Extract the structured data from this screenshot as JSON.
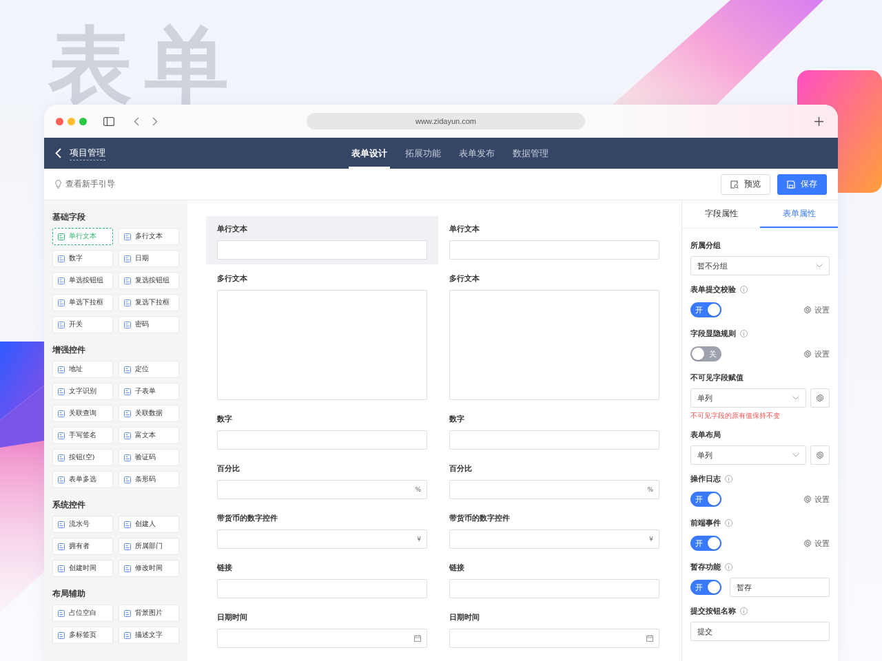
{
  "hero_title": "表单",
  "browser": {
    "url": "www.zidayun.com"
  },
  "nav": {
    "back_label": "项目管理",
    "tabs": [
      {
        "label": "表单设计",
        "selected": true
      },
      {
        "label": "拓展功能",
        "selected": false
      },
      {
        "label": "表单发布",
        "selected": false
      },
      {
        "label": "数据管理",
        "selected": false
      }
    ]
  },
  "toolbar": {
    "guide": "查看新手引导",
    "buttons": [
      {
        "label": "预览",
        "kind": "secondary"
      },
      {
        "label": "保存",
        "kind": "primary"
      }
    ]
  },
  "palette": {
    "groups": [
      {
        "title": "基础字段",
        "items": [
          {
            "label": "单行文本",
            "selected": true
          },
          {
            "label": "多行文本",
            "selected": false
          },
          {
            "label": "数字",
            "selected": false
          },
          {
            "label": "日期",
            "selected": false
          },
          {
            "label": "单选按钮组",
            "selected": false
          },
          {
            "label": "复选按钮组",
            "selected": false
          },
          {
            "label": "单选下拉框",
            "selected": false
          },
          {
            "label": "复选下拉框",
            "selected": false
          },
          {
            "label": "开关",
            "selected": false
          },
          {
            "label": "密码",
            "selected": false
          }
        ]
      },
      {
        "title": "增强控件",
        "items": [
          {
            "label": "地址",
            "selected": false
          },
          {
            "label": "定位",
            "selected": false
          },
          {
            "label": "文字识别",
            "selected": false
          },
          {
            "label": "子表单",
            "selected": false
          },
          {
            "label": "关联查询",
            "selected": false
          },
          {
            "label": "关联数据",
            "selected": false
          },
          {
            "label": "手写签名",
            "selected": false
          },
          {
            "label": "富文本",
            "selected": false
          },
          {
            "label": "按钮(空)",
            "selected": false
          },
          {
            "label": "验证码",
            "selected": false
          },
          {
            "label": "表单多选",
            "selected": false
          },
          {
            "label": "条形码",
            "selected": false
          }
        ]
      },
      {
        "title": "系统控件",
        "items": [
          {
            "label": "流水号",
            "selected": false
          },
          {
            "label": "创建人",
            "selected": false
          },
          {
            "label": "拥有者",
            "selected": false
          },
          {
            "label": "所属部门",
            "selected": false
          },
          {
            "label": "创建时间",
            "selected": false
          },
          {
            "label": "修改时间",
            "selected": false
          }
        ]
      },
      {
        "title": "布局辅助",
        "items": [
          {
            "label": "占位空白",
            "selected": false
          },
          {
            "label": "背景图片",
            "selected": false
          },
          {
            "label": "多标签页",
            "selected": false
          },
          {
            "label": "描述文字",
            "selected": false
          }
        ]
      }
    ]
  },
  "canvas": {
    "columns": [
      {
        "fields": [
          {
            "label": "单行文本",
            "kind": "input",
            "selected": true
          },
          {
            "label": "多行文本",
            "kind": "textarea",
            "selected": false
          },
          {
            "label": "数字",
            "kind": "input",
            "selected": false
          },
          {
            "label": "百分比",
            "kind": "input",
            "suffix": "%",
            "selected": false
          },
          {
            "label": "带货币的数字控件",
            "kind": "input",
            "suffix": "¥",
            "selected": false
          },
          {
            "label": "链接",
            "kind": "input",
            "selected": false
          },
          {
            "label": "日期时间",
            "kind": "date",
            "selected": false
          }
        ]
      },
      {
        "fields": [
          {
            "label": "单行文本",
            "kind": "input",
            "selected": false
          },
          {
            "label": "多行文本",
            "kind": "textarea",
            "selected": false
          },
          {
            "label": "数字",
            "kind": "input",
            "selected": false
          },
          {
            "label": "百分比",
            "kind": "input",
            "suffix": "%",
            "selected": false
          },
          {
            "label": "带货币的数字控件",
            "kind": "input",
            "suffix": "¥",
            "selected": false
          },
          {
            "label": "链接",
            "kind": "input",
            "selected": false
          },
          {
            "label": "日期时间",
            "kind": "date",
            "selected": false
          }
        ]
      }
    ]
  },
  "properties": {
    "tabs": [
      {
        "label": "字段属性",
        "selected": false
      },
      {
        "label": "表单属性",
        "selected": true
      }
    ],
    "settings": [
      {
        "kind": "select",
        "label": "所属分组",
        "info": false,
        "value": "暂不分组"
      },
      {
        "kind": "switch",
        "label": "表单提交校验",
        "info": true,
        "on": true,
        "switch_text": "开",
        "action": "设置"
      },
      {
        "kind": "switch",
        "label": "字段显隐规则",
        "info": true,
        "on": false,
        "switch_text": "关",
        "action": "设置"
      },
      {
        "kind": "select_gear",
        "label": "不可见字段赋值",
        "info": false,
        "value": "单列",
        "note": "不可见字段的原有值保持不变"
      },
      {
        "kind": "select_gear",
        "label": "表单布局",
        "info": false,
        "value": "单列"
      },
      {
        "kind": "switch",
        "label": "操作日志",
        "info": true,
        "on": true,
        "switch_text": "开",
        "action": "设置"
      },
      {
        "kind": "switch",
        "label": "前端事件",
        "info": true,
        "on": true,
        "switch_text": "开",
        "action": "设置"
      },
      {
        "kind": "switch_input",
        "label": "暂存功能",
        "info": true,
        "on": true,
        "switch_text": "开",
        "value": "暂存"
      },
      {
        "kind": "input",
        "label": "提交按钮名称",
        "info": true,
        "value": "提交"
      }
    ]
  }
}
